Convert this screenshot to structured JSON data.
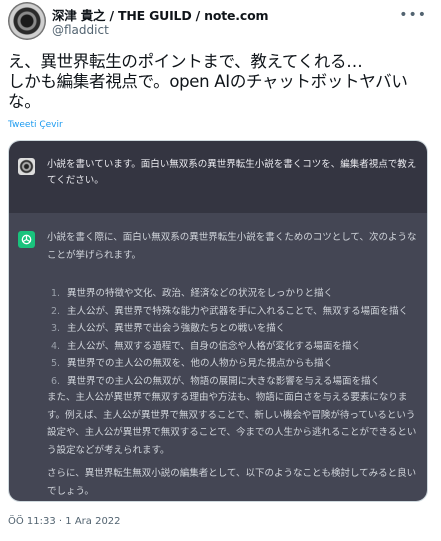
{
  "author": {
    "display_name": "深津 貴之 / THE GUILD / note.com",
    "handle": "@fladdict"
  },
  "tweet": {
    "text": "え、異世界転生のポイントまで、教えてくれる…\nしかも編集者視点で。open AIのチャットボットヤバいな。",
    "translate_label": "Tweeti Çevir",
    "timestamp": "ÖÖ 11:33 · 1 Ara 2022"
  },
  "chat": {
    "prompt": "小説を書いています。面白い無双系の異世界転生小説を書くコツを、編集者視点で教えてください。",
    "answer_intro": "小説を書く際に、面白い無双系の異世界転生小説を書くためのコツとして、次のようなことが挙げられます。",
    "answer_list": [
      {
        "num": "1.",
        "text": "異世界の特徴や文化、政治、経済などの状況をしっかりと描く"
      },
      {
        "num": "2.",
        "text": "主人公が、異世界で特殊な能力や武器を手に入れることで、無双する場面を描く"
      },
      {
        "num": "3.",
        "text": "主人公が、異世界で出会う強敵たちとの戦いを描く"
      },
      {
        "num": "4.",
        "text": "主人公が、無双する過程で、自身の信念や人格が変化する場面を描く"
      },
      {
        "num": "5.",
        "text": "異世界での主人公の無双を、他の人物から見た視点からも描く"
      },
      {
        "num": "6.",
        "text": "異世界での主人公の無双が、物語の展開に大きな影響を与える場面を描く"
      }
    ],
    "answer_para2": "また、主人公が異世界で無双する理由や方法も、物語に面白さを与える要素になります。例えば、主人公が異世界で無双することで、新しい機会や冒険が待っているという設定や、主人公が異世界で無双することで、今までの人生から逃れることができるという設定などが考えられます。",
    "answer_para3": "さらに、異世界転生無双小説の編集者として、以下のようなことも検討してみると良いでしょう。"
  },
  "colors": {
    "prompt_bg": "#343541",
    "answer_bg": "#444654",
    "gpt_icon": "#19c37d",
    "link": "#1d9bf0"
  },
  "icons": {
    "more": "more-horizontal-icon",
    "gpt": "openai-logo-icon"
  }
}
